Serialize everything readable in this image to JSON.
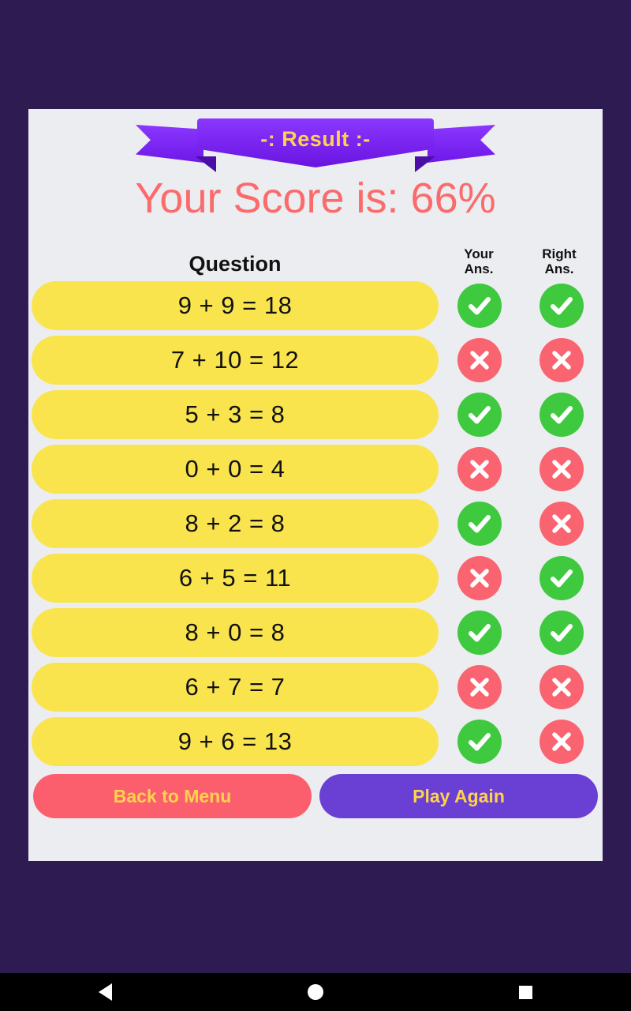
{
  "app": {
    "background_color": "#2d1b52",
    "card_color": "#ebedf1"
  },
  "banner": {
    "label": "-: Result :-",
    "text_color": "#ffd24d",
    "ribbon_color": "#7b2ff7"
  },
  "score": {
    "text": "Your Score is: 66%",
    "percent": 66,
    "color": "#fb6b6b"
  },
  "table": {
    "headers": {
      "question": "Question",
      "your_answer_line1": "Your",
      "your_answer_line2": "Ans.",
      "right_answer_line1": "Right",
      "right_answer_line2": "Ans."
    },
    "correct_icon": "check-circle-icon",
    "wrong_icon": "cross-circle-icon",
    "correct_color": "#3fc93f",
    "wrong_color": "#fa6470",
    "pill_color": "#fae44e",
    "rows": [
      {
        "question": "9 + 9 = 18",
        "your_answer": "correct",
        "right_answer": "correct"
      },
      {
        "question": "7 + 10 = 12",
        "your_answer": "wrong",
        "right_answer": "wrong"
      },
      {
        "question": "5 + 3 = 8",
        "your_answer": "correct",
        "right_answer": "correct"
      },
      {
        "question": "0 + 0 = 4",
        "your_answer": "wrong",
        "right_answer": "wrong"
      },
      {
        "question": "8 + 2 = 8",
        "your_answer": "correct",
        "right_answer": "wrong"
      },
      {
        "question": "6 + 5 = 11",
        "your_answer": "wrong",
        "right_answer": "correct"
      },
      {
        "question": "8 + 0 = 8",
        "your_answer": "correct",
        "right_answer": "correct"
      },
      {
        "question": "6 + 7 = 7",
        "your_answer": "wrong",
        "right_answer": "wrong"
      },
      {
        "question": "9 + 6 = 13",
        "your_answer": "correct",
        "right_answer": "wrong"
      }
    ]
  },
  "buttons": {
    "back_to_menu": "Back to Menu",
    "play_again": "Play Again",
    "back_color": "#fb5f6e",
    "play_color": "#6a3fd4",
    "label_color": "#ffd24d"
  },
  "navbar": {
    "back": "back-triangle-icon",
    "home": "home-circle-icon",
    "recents": "recents-square-icon"
  }
}
